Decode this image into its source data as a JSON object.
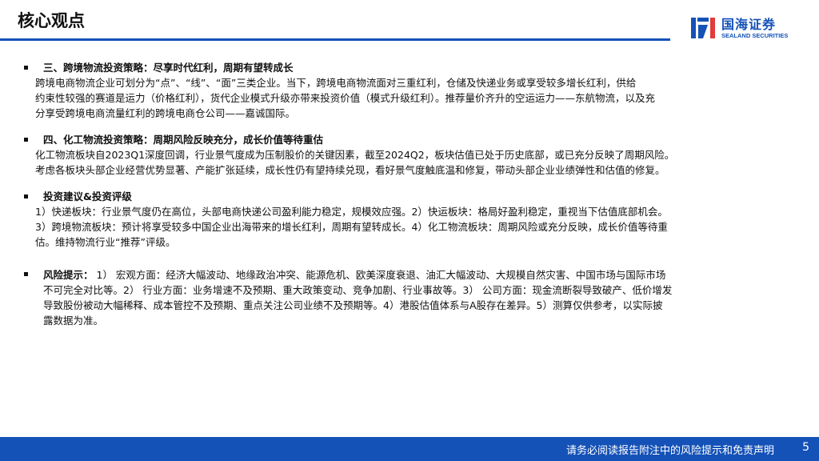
{
  "header": {
    "title": "核心观点",
    "logo": {
      "cn": "国海证券",
      "en": "SEALAND SECURITIES",
      "color": "#1552b8"
    }
  },
  "sections": [
    {
      "heading": "三、跨境物流投资策略：尽享时代红利，周期有望转成长",
      "lines": [
        "跨境电商物流企业可划分为“点”、“线”、“面”三类企业。当下，跨境电商物流面对三重红利，仓储及快递业务或享受较多增长红利，供给",
        "约束性较强的赛道是运力（价格红利），货代企业模式升级亦带来投资价值（模式升级红利）。推荐量价齐升的空运运力——东航物流，以及充",
        "分享受跨境电商流量红利的跨境电商仓公司——嘉诚国际。"
      ]
    },
    {
      "heading": "四、化工物流投资策略：周期风险反映充分，成长价值等待重估",
      "lines": [
        "化工物流板块自2023Q1深度回调，行业景气度成为压制股价的关键因素，截至2024Q2，板块估值已处于历史底部，或已充分反映了周期风险。",
        "考虑各板块头部企业经营优势显著、产能扩张延续，成长性仍有望持续兑现，看好景气度触底温和修复，带动头部企业业绩弹性和估值的修复。"
      ]
    },
    {
      "heading": "投资建议&投资评级",
      "lines": [
        "1）快递板块：行业景气度仍在高位，头部电商快递公司盈利能力稳定，规模效应强。2）快运板块：格局好盈利稳定，重视当下估值底部机会。",
        "3）跨境物流板块：预计将享受较多中国企业出海带来的增长红利，周期有望转成长。4）化工物流板块：周期风险或充分反映，成长价值等待重",
        "估。维持物流行业“推荐”评级。"
      ]
    }
  ],
  "risk": {
    "label": "风险提示：",
    "first_line": " 1） 宏观方面：经济大幅波动、地缘政治冲突、能源危机、欧美深度衰退、油汇大幅波动、大规模自然灾害、中国市场与国际市场",
    "lines": [
      "不可完全对比等。2） 行业方面：业务增速不及预期、重大政策变动、竞争加剧、行业事故等。3） 公司方面：现金流断裂导致破产、低价增发",
      "导致股份被动大幅稀释、成本管控不及预期、重点关注公司业绩不及预期等。4）港股估值体系与A股存在差异。5）测算仅供参考，以实际披",
      "露数据为准。"
    ]
  },
  "footer": {
    "disclaimer": "请务必阅读报告附注中的风险提示和免责声明",
    "page_number": "5",
    "bar_color": "#1552b8"
  }
}
